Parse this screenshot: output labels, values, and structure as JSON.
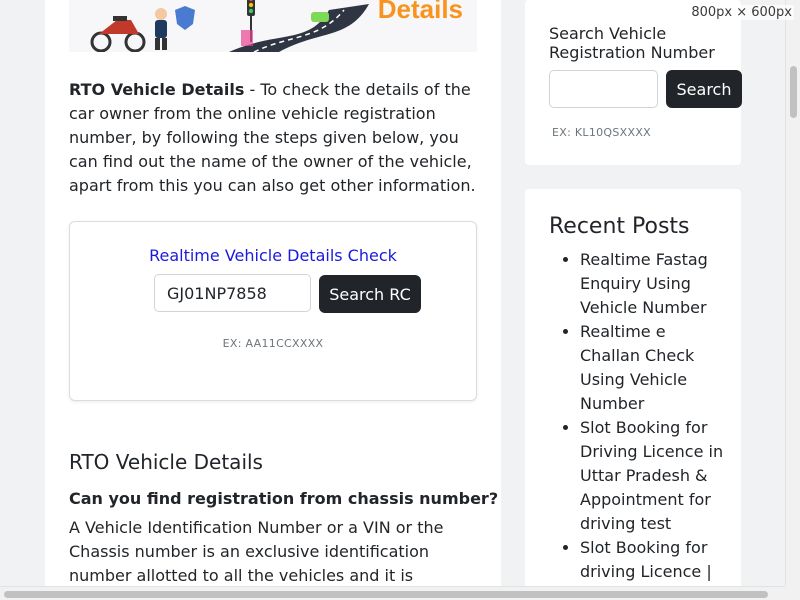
{
  "viewport_label": "800px × 600px",
  "banner": {
    "title": "Details"
  },
  "intro": {
    "bold": "RTO Vehicle Details",
    "text": " - To check the details of the car owner from the online vehicle registration number, by following the steps given below, you can find out the name of the owner of the vehicle, apart from this you can also get other information."
  },
  "check": {
    "title": "Realtime Vehicle Details Check",
    "input_value": "GJ01NP7858",
    "button": "Search RC",
    "hint": "EX: AA11CCXXXX"
  },
  "section": {
    "heading": "RTO Vehicle Details",
    "subheading": "Can you find registration from chassis number?",
    "paragraph": "A Vehicle Identification Number or a VIN or the Chassis number is an exclusive identification number allotted to all the vehicles and it is through this number the"
  },
  "sidebar_search": {
    "title": "Search Vehicle Registration Number",
    "input_value": "",
    "button": "Search",
    "hint": "EX: KL10QSXXXX"
  },
  "recent_posts": {
    "title": "Recent Posts",
    "items": [
      "Realtime Fastag Enquiry Using Vehicle Number",
      "Realtime e Challan Check Using Vehicle Number",
      "Slot Booking for Driving Licence in Uttar Pradesh & Appointment for driving test",
      "Slot Booking for driving Licence | Learning Licence"
    ]
  },
  "colors": {
    "accent_orange": "#f7941d",
    "link_blue": "#1a1adf",
    "button_dark": "#212529"
  }
}
